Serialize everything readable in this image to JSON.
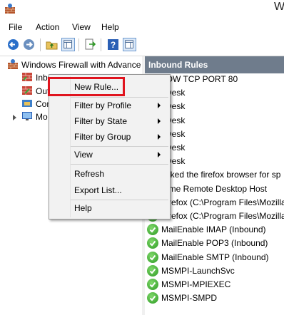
{
  "window": {
    "title": "W"
  },
  "menubar": {
    "items": [
      "File",
      "Action",
      "View",
      "Help"
    ]
  },
  "tree": {
    "root": "Windows Firewall with Advance",
    "children": [
      {
        "label": "Inbound Rules",
        "icon": "inbound-rules-icon"
      },
      {
        "label": "Out",
        "icon": "outbound-rules-icon"
      },
      {
        "label": "Con",
        "icon": "connection-security-icon"
      },
      {
        "label": "Mo",
        "icon": "monitoring-icon"
      }
    ]
  },
  "rules_pane": {
    "header": "Inbound Rules",
    "rows": [
      {
        "name": "LOW TCP PORT 80",
        "icon": "rule-icon"
      },
      {
        "name": "yDesk",
        "icon": "rule-icon"
      },
      {
        "name": "yDesk",
        "icon": "rule-icon"
      },
      {
        "name": "yDesk",
        "icon": "rule-icon"
      },
      {
        "name": "yDesk",
        "icon": "rule-icon"
      },
      {
        "name": "yDesk",
        "icon": "rule-icon"
      },
      {
        "name": "yDesk",
        "icon": "rule-icon"
      },
      {
        "name": "ocked the firefox browser for sp",
        "icon": "rule-icon"
      },
      {
        "name": "rome Remote Desktop Host",
        "icon": "rule-icon"
      },
      {
        "name": "Firefox (C:\\Program Files\\Mozilla",
        "icon": "allow-check-icon"
      },
      {
        "name": "Firefox (C:\\Program Files\\Mozilla",
        "icon": "allow-check-icon"
      },
      {
        "name": "MailEnable IMAP (Inbound)",
        "icon": "allow-check-icon"
      },
      {
        "name": "MailEnable POP3 (Inbound)",
        "icon": "allow-check-icon"
      },
      {
        "name": "MailEnable SMTP (Inbound)",
        "icon": "allow-check-icon"
      },
      {
        "name": "MSMPI-LaunchSvc",
        "icon": "allow-check-icon"
      },
      {
        "name": "MSMPI-MPIEXEC",
        "icon": "allow-check-icon"
      },
      {
        "name": "MSMPI-SMPD",
        "icon": "allow-check-icon"
      }
    ]
  },
  "context_menu": {
    "new_rule": "New Rule...",
    "filter_profile": "Filter by Profile",
    "filter_state": "Filter by State",
    "filter_group": "Filter by Group",
    "view": "View",
    "refresh": "Refresh",
    "export": "Export List...",
    "help": "Help"
  },
  "colors": {
    "highlight_box": "#e0141e",
    "header_bg": "#6f7c8c",
    "allow_green": "#2c9a23"
  }
}
